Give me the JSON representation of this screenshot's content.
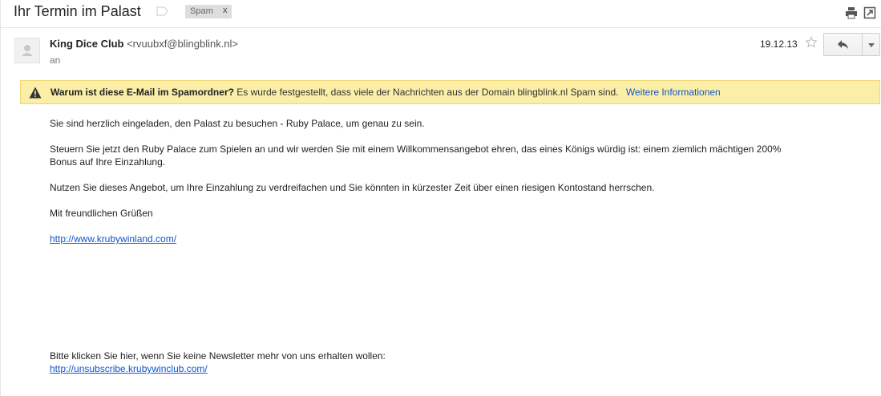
{
  "header": {
    "subject": "Ihr Termin im Palast",
    "label": "Spam",
    "label_remove": "x",
    "print_icon": "print-icon",
    "popout_icon": "new-window-icon"
  },
  "message": {
    "sender_name": "King Dice Club",
    "sender_email": "<rvuubxf@blingblink.nl>",
    "recipient": "an",
    "date": "19.12.13",
    "star_icon": "star-icon",
    "reply_icon": "reply-icon",
    "more_icon": "chevron-down-icon"
  },
  "spam_warning": {
    "heading": "Warum ist diese E-Mail im Spamordner?",
    "text": "Es wurde festgestellt, dass viele der Nachrichten aus der Domain blingblink.nl Spam sind.",
    "link": "Weitere Informationen",
    "color": "#fbeea6"
  },
  "body": {
    "p1": "Sie sind herzlich eingeladen, den Palast zu besuchen - Ruby Palace, um genau zu sein.",
    "p2_line1": "Steuern Sie jetzt den Ruby Palace zum Spielen an und wir werden Sie mit einem Willkommensangebot ehren, das eines Königs würdig ist: einem ziemlich mächtigen 200%",
    "p2_line2": "Bonus auf Ihre Einzahlung.",
    "p3": "Nutzen Sie dieses Angebot, um Ihre Einzahlung zu verdreifachen und Sie könnten in kürzester Zeit über einen riesigen Kontostand herrschen.",
    "greeting": "Mit freundlichen Grüßen",
    "link1": "http://www.krubywinland.com/",
    "unsubscribe_text": "Bitte klicken Sie hier, wenn Sie keine Newsletter mehr von uns erhalten wollen:",
    "unsubscribe_link": "http://unsubscribe.krubywinclub.com/"
  }
}
